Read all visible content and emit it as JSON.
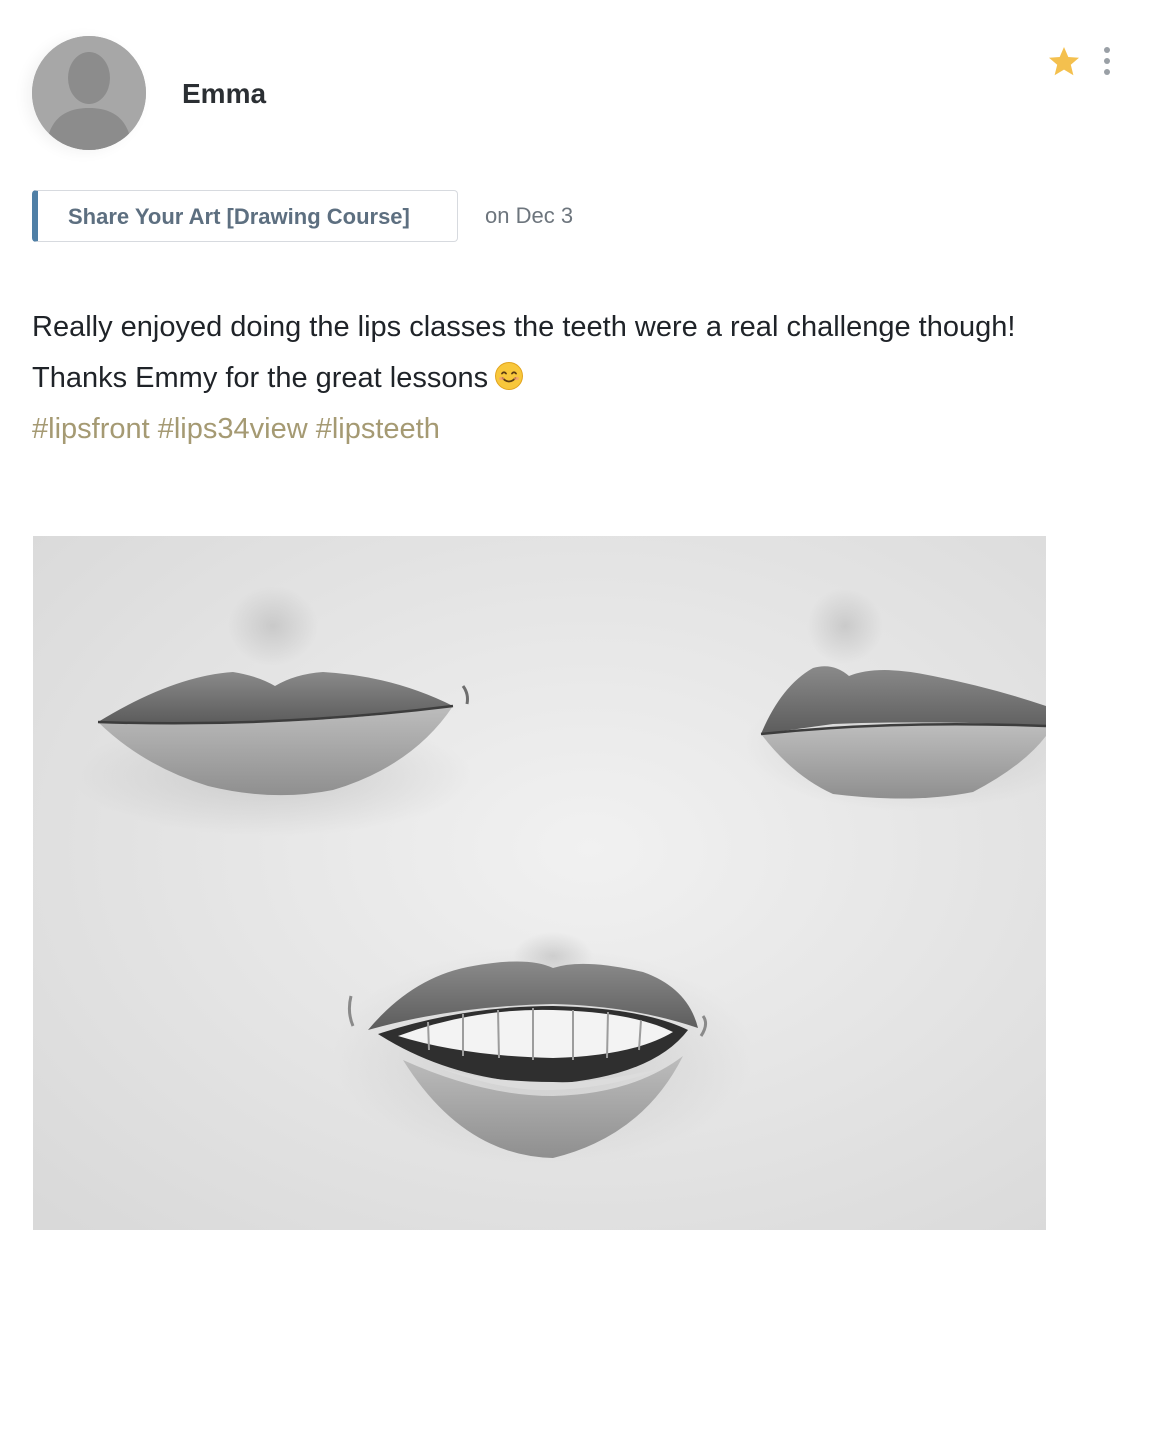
{
  "post": {
    "author": "Emma",
    "category": "Share Your Art [Drawing Course]",
    "date": "on Dec 3",
    "body_line1": "Really enjoyed doing the lips classes the teeth were a real challenge though!",
    "body_line2": "Thanks Emmy for the great lessons",
    "tags": [
      "#lipsfront",
      "#lips34view",
      "#lipsteeth"
    ],
    "emoji": "smiling-face-icon"
  },
  "colors": {
    "accent_bar": "#4f7fa6",
    "tag_color": "#a59a73",
    "star": "#f4c04e",
    "avatar_bg": "#a7a7a7"
  },
  "icons": {
    "avatar": "default-user-icon",
    "star": "star-icon",
    "more": "vertical-dots-icon"
  },
  "image": {
    "description_label": "pencil drawing of three lips"
  }
}
